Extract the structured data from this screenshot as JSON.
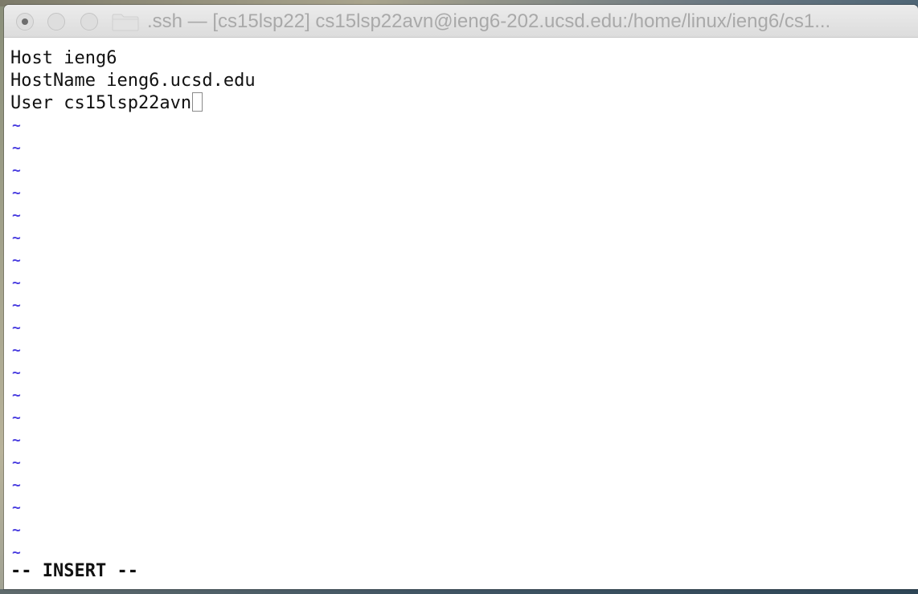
{
  "window": {
    "title": ".ssh — [cs15lsp22]  cs15lsp22avn@ieng6-202.ucsd.edu:/home/linux/ieng6/cs1..."
  },
  "titlebar": {
    "close_icon": "close-icon",
    "minimize_icon": "minimize-icon",
    "zoom_icon": "zoom-icon",
    "folder_icon": "folder-icon"
  },
  "editor": {
    "lines": [
      "Host ieng6",
      "HostName ieng6.ucsd.edu",
      "User cs15lsp22avn"
    ],
    "empty_line_marker": "~",
    "empty_line_count": 20,
    "mode_text": "-- INSERT --"
  },
  "colors": {
    "tilde": "#4a3ee0",
    "text": "#111111",
    "title_text": "#a9a9a9"
  }
}
